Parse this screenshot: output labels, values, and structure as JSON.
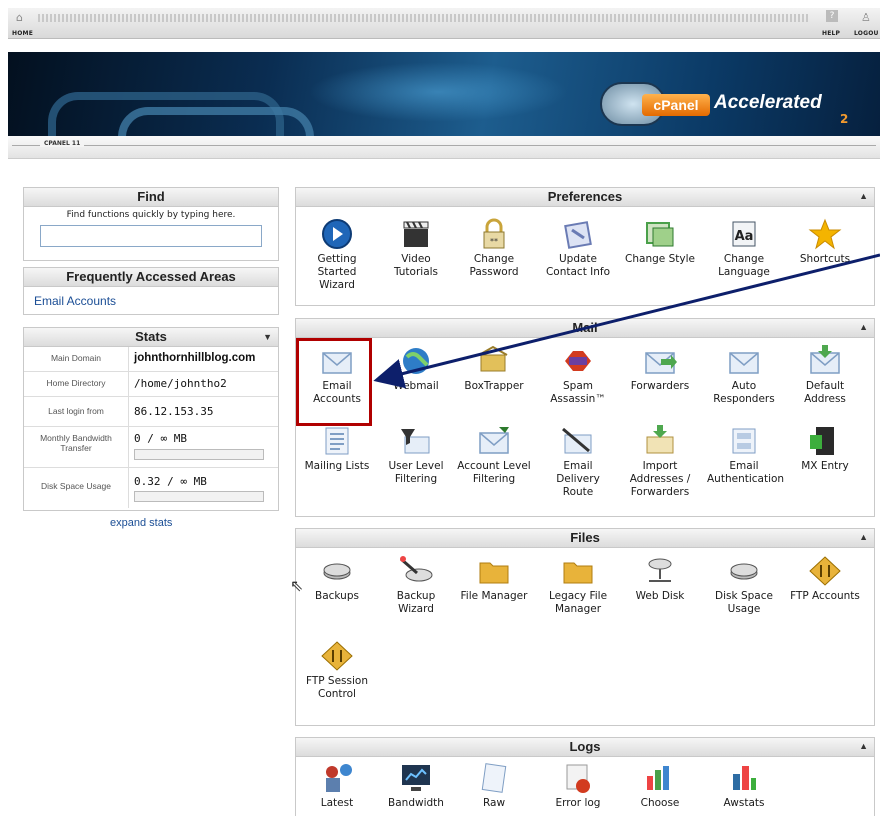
{
  "topbar": {
    "home_label": "HOME",
    "help_label": "HELP",
    "logout_label": "LOGOU"
  },
  "banner": {
    "logo_badge": "cPanel",
    "logo_text": "Accelerated",
    "logo_suffix": "2"
  },
  "version_label": "CPANEL 11",
  "find": {
    "title": "Find",
    "hint": "Find functions quickly by typing here.",
    "value": ""
  },
  "frequent": {
    "title": "Frequently Accessed Areas",
    "items": [
      "Email Accounts"
    ]
  },
  "stats": {
    "title": "Stats",
    "rows": [
      {
        "label": "Main Domain",
        "value": "johnthornhillblog.com"
      },
      {
        "label": "Home Directory",
        "value": "/home/johntho2"
      },
      {
        "label": "Last login from",
        "value": "86.12.153.35"
      },
      {
        "label": "Monthly Bandwidth Transfer",
        "value": "0 / ∞ MB"
      },
      {
        "label": "Disk Space Usage",
        "value": "0.32 / ∞ MB"
      }
    ],
    "expand_label": "expand stats"
  },
  "sections": {
    "preferences": {
      "title": "Preferences",
      "items": [
        {
          "name": "getting-started-wizard",
          "label": "Getting Started Wizard",
          "icon": "play-icon",
          "color": "#1f66b8"
        },
        {
          "name": "video-tutorials",
          "label": "Video Tutorials",
          "icon": "clapperboard-icon",
          "color": "#333333"
        },
        {
          "name": "change-password",
          "label": "Change Password",
          "icon": "padlock-icon",
          "color": "#c9a43a"
        },
        {
          "name": "update-contact-info",
          "label": "Update Contact Info",
          "icon": "contact-card-icon",
          "color": "#6a7bb4"
        },
        {
          "name": "change-style",
          "label": "Change Style",
          "icon": "palette-icon",
          "color": "#4aa04a"
        },
        {
          "name": "change-language",
          "label": "Change Language",
          "icon": "language-icon",
          "color": "#445566"
        },
        {
          "name": "shortcuts",
          "label": "Shortcuts",
          "icon": "star-icon",
          "color": "#f4b400"
        }
      ]
    },
    "mail": {
      "title": "Mail",
      "items": [
        {
          "name": "email-accounts",
          "label": "Email Accounts",
          "icon": "envelope-icon",
          "color": "#8fb3d9"
        },
        {
          "name": "webmail",
          "label": "Webmail",
          "icon": "globe-icon",
          "color": "#2e7dc7"
        },
        {
          "name": "boxtrapper",
          "label": "BoxTrapper",
          "icon": "box-trap-icon",
          "color": "#e2c05a"
        },
        {
          "name": "spamassassin",
          "label": "Spam Assassin™",
          "icon": "spam-icon",
          "color": "#d23b1f"
        },
        {
          "name": "forwarders",
          "label": "Forwarders",
          "icon": "forward-envelope-icon",
          "color": "#4fa84f"
        },
        {
          "name": "auto-responders",
          "label": "Auto Responders",
          "icon": "auto-reply-icon",
          "color": "#8fb3d9"
        },
        {
          "name": "default-address",
          "label": "Default Address",
          "icon": "download-envelope-icon",
          "color": "#4fa84f"
        },
        {
          "name": "mailing-lists",
          "label": "Mailing Lists",
          "icon": "list-icon",
          "color": "#8fb3d9"
        },
        {
          "name": "user-level-filtering",
          "label": "User Level Filtering",
          "icon": "filter-funnel-icon",
          "color": "#333333"
        },
        {
          "name": "account-level-filtering",
          "label": "Account Level Filtering",
          "icon": "filter-envelope-icon",
          "color": "#8fb3d9"
        },
        {
          "name": "email-delivery-route",
          "label": "Email Delivery Route",
          "icon": "route-icon",
          "color": "#333333"
        },
        {
          "name": "import-addresses-forwarders",
          "label": "Import Addresses / Forwarders",
          "icon": "import-icon",
          "color": "#4fa84f"
        },
        {
          "name": "email-authentication",
          "label": "Email Authentication",
          "icon": "auth-icon",
          "color": "#8fb3d9"
        },
        {
          "name": "mx-entry",
          "label": "MX Entry",
          "icon": "server-icon",
          "color": "#2a2a2a"
        }
      ]
    },
    "files": {
      "title": "Files",
      "items": [
        {
          "name": "backups",
          "label": "Backups",
          "icon": "disk-drive-icon",
          "color": "#8a8a8a"
        },
        {
          "name": "backup-wizard",
          "label": "Backup Wizard",
          "icon": "wand-disk-icon",
          "color": "#8a8a8a"
        },
        {
          "name": "file-manager",
          "label": "File Manager",
          "icon": "folder-icon",
          "color": "#e8b33a"
        },
        {
          "name": "legacy-file-manager",
          "label": "Legacy File Manager",
          "icon": "folder-icon",
          "color": "#e8b33a"
        },
        {
          "name": "web-disk",
          "label": "Web Disk",
          "icon": "network-disk-icon",
          "color": "#8a8a8a"
        },
        {
          "name": "disk-space-usage",
          "label": "Disk Space Usage",
          "icon": "disk-drive-icon",
          "color": "#8a8a8a"
        },
        {
          "name": "ftp-accounts",
          "label": "FTP Accounts",
          "icon": "ftp-icon",
          "color": "#e8b33a"
        },
        {
          "name": "ftp-session-control",
          "label": "FTP Session Control",
          "icon": "ftp-session-icon",
          "color": "#e8b33a"
        }
      ]
    },
    "logs": {
      "title": "Logs",
      "items": [
        {
          "name": "latest-visitors",
          "label": "Latest",
          "icon": "visitors-icon",
          "color": "#c0392b"
        },
        {
          "name": "bandwidth",
          "label": "Bandwidth",
          "icon": "monitor-chart-icon",
          "color": "#2e6da4"
        },
        {
          "name": "raw-access-logs",
          "label": "Raw",
          "icon": "scroll-icon",
          "color": "#8fb3d9"
        },
        {
          "name": "error-log",
          "label": "Error log",
          "icon": "error-icon",
          "color": "#d23b1f"
        },
        {
          "name": "choose-log-programs",
          "label": "Choose",
          "icon": "chart-icon",
          "color": "#4aa04a"
        },
        {
          "name": "awstats",
          "label": "Awstats",
          "icon": "bar-chart-icon",
          "color": "#2e6da4"
        }
      ]
    }
  }
}
